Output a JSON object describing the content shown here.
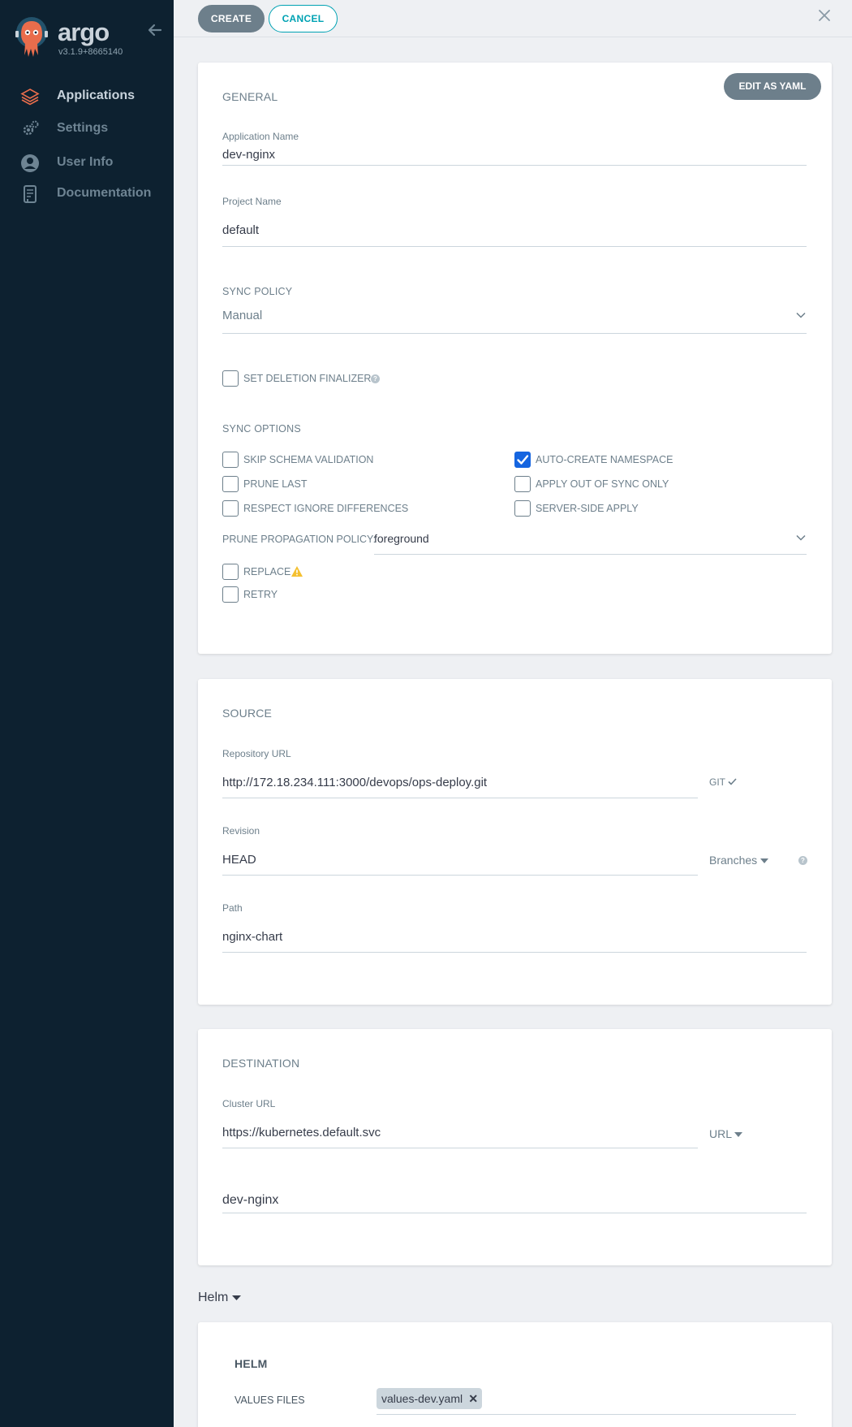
{
  "app": {
    "brand": "argo",
    "version": "v3.1.9+8665140"
  },
  "sidebar": {
    "items": [
      {
        "label": "Applications",
        "icon": "layers-icon",
        "active": true
      },
      {
        "label": "Settings",
        "icon": "gears-icon",
        "active": false
      },
      {
        "label": "User Info",
        "icon": "user-circle-icon",
        "active": false
      },
      {
        "label": "Documentation",
        "icon": "book-icon",
        "active": false
      }
    ]
  },
  "toolbar": {
    "create_label": "CREATE",
    "cancel_label": "CANCEL"
  },
  "general": {
    "title": "GENERAL",
    "edit_yaml_label": "EDIT AS YAML",
    "app_name_label": "Application Name",
    "app_name_value": "dev-nginx",
    "project_label": "Project Name",
    "project_value": "default",
    "sync_policy_label": "SYNC POLICY",
    "sync_policy_value": "Manual",
    "deletion_finalizer_label": "SET DELETION FINALIZER",
    "sync_options_title": "SYNC OPTIONS",
    "sync_options": [
      {
        "label": "SKIP SCHEMA VALIDATION",
        "checked": false
      },
      {
        "label": "AUTO-CREATE NAMESPACE",
        "checked": true
      },
      {
        "label": "PRUNE LAST",
        "checked": false
      },
      {
        "label": "APPLY OUT OF SYNC ONLY",
        "checked": false
      },
      {
        "label": "RESPECT IGNORE DIFFERENCES",
        "checked": false
      },
      {
        "label": "SERVER-SIDE APPLY",
        "checked": false
      }
    ],
    "prune_policy_label": "PRUNE PROPAGATION POLICY:",
    "prune_policy_value": "foreground",
    "replace_label": "REPLACE",
    "retry_label": "RETRY"
  },
  "source": {
    "title": "SOURCE",
    "repo_label": "Repository URL",
    "repo_value": "http://172.18.234.111:3000/devops/ops-deploy.git",
    "repo_type": "GIT",
    "revision_label": "Revision",
    "revision_value": "HEAD",
    "revision_mode": "Branches",
    "path_label": "Path",
    "path_value": "nginx-chart"
  },
  "destination": {
    "title": "DESTINATION",
    "cluster_label": "Cluster URL",
    "cluster_value": "https://kubernetes.default.svc",
    "cluster_mode": "URL",
    "namespace_value": "dev-nginx"
  },
  "helm": {
    "toggle_label": "Helm",
    "title": "HELM",
    "values_files_label": "VALUES FILES",
    "values_files": [
      "values-dev.yaml"
    ]
  },
  "colors": {
    "sidebar_bg": "#0d2130",
    "accent": "#00a2b3",
    "button_grey": "#6d7f8b",
    "checkbox_checked": "#1565e0",
    "warning": "#f4c030",
    "logo_orange": "#e96d4c"
  }
}
